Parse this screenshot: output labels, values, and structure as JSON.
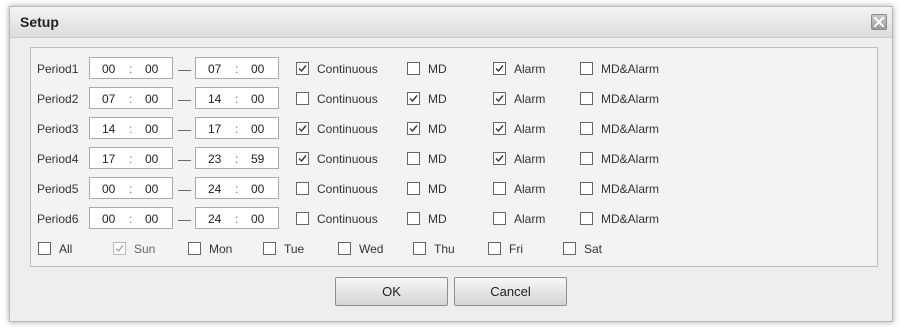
{
  "dialog": {
    "title": "Setup",
    "close_icon": "close-icon",
    "ok_label": "OK",
    "cancel_label": "Cancel"
  },
  "time_separator": ":",
  "period_separator": "—",
  "option_labels": [
    "Continuous",
    "MD",
    "Alarm",
    "MD&Alarm"
  ],
  "periods": [
    {
      "label": "Period1",
      "start_h": "00",
      "start_m": "00",
      "end_h": "07",
      "end_m": "00",
      "continuous": true,
      "md": false,
      "alarm": true,
      "md_alarm": false
    },
    {
      "label": "Period2",
      "start_h": "07",
      "start_m": "00",
      "end_h": "14",
      "end_m": "00",
      "continuous": false,
      "md": true,
      "alarm": true,
      "md_alarm": false
    },
    {
      "label": "Period3",
      "start_h": "14",
      "start_m": "00",
      "end_h": "17",
      "end_m": "00",
      "continuous": true,
      "md": true,
      "alarm": true,
      "md_alarm": false
    },
    {
      "label": "Period4",
      "start_h": "17",
      "start_m": "00",
      "end_h": "23",
      "end_m": "59",
      "continuous": true,
      "md": false,
      "alarm": true,
      "md_alarm": false
    },
    {
      "label": "Period5",
      "start_h": "00",
      "start_m": "00",
      "end_h": "24",
      "end_m": "00",
      "continuous": false,
      "md": false,
      "alarm": false,
      "md_alarm": false
    },
    {
      "label": "Period6",
      "start_h": "00",
      "start_m": "00",
      "end_h": "24",
      "end_m": "00",
      "continuous": false,
      "md": false,
      "alarm": false,
      "md_alarm": false
    }
  ],
  "days": [
    {
      "label": "All",
      "checked": false,
      "disabled": false
    },
    {
      "label": "Sun",
      "checked": true,
      "disabled": true
    },
    {
      "label": "Mon",
      "checked": false,
      "disabled": false
    },
    {
      "label": "Tue",
      "checked": false,
      "disabled": false
    },
    {
      "label": "Wed",
      "checked": false,
      "disabled": false
    },
    {
      "label": "Thu",
      "checked": false,
      "disabled": false
    },
    {
      "label": "Fri",
      "checked": false,
      "disabled": false
    },
    {
      "label": "Sat",
      "checked": false,
      "disabled": false
    }
  ]
}
